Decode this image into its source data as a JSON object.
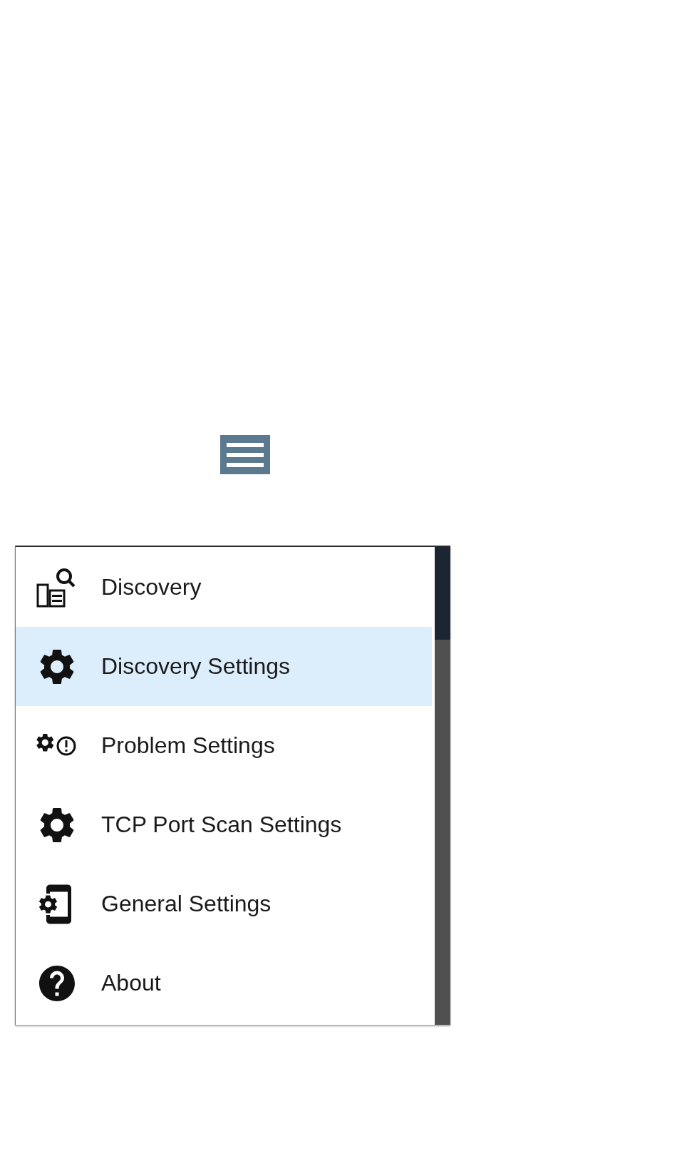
{
  "menu_button": {
    "kind": "hamburger"
  },
  "menu": {
    "items": [
      {
        "label": "Discovery",
        "kind": "discovery",
        "selected": false
      },
      {
        "label": "Discovery Settings",
        "kind": "gear",
        "selected": true
      },
      {
        "label": "Problem Settings",
        "kind": "gear-alert",
        "selected": false
      },
      {
        "label": "TCP Port Scan Settings",
        "kind": "gear",
        "selected": false
      },
      {
        "label": "General Settings",
        "kind": "phone-gear",
        "selected": false
      },
      {
        "label": "About",
        "kind": "help",
        "selected": false
      }
    ]
  }
}
